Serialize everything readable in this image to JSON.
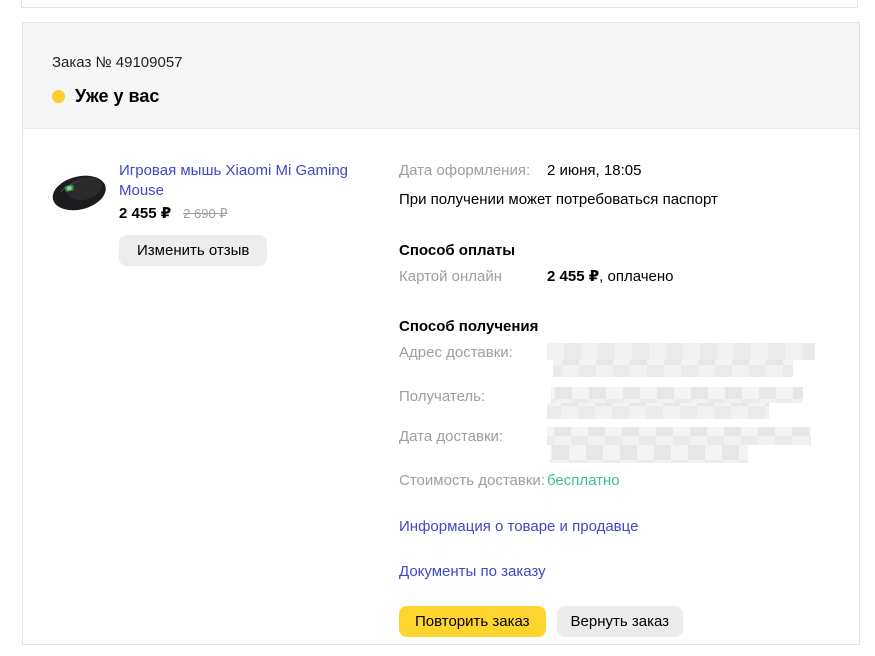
{
  "order": {
    "number_label": "Заказ № 49109057",
    "status": "Уже у вас"
  },
  "product": {
    "title": "Игровая мышь Xiaomi Mi Gaming Mouse",
    "price": "2 455 ₽",
    "old_price": "2 690 ₽",
    "review_button": "Изменить отзыв"
  },
  "details": {
    "date_label": "Дата оформления:",
    "date_value": "2 июня, 18:05",
    "passport_note": "При получении может потребоваться паспорт",
    "payment": {
      "heading": "Способ оплаты",
      "method_label": "Картой онлайн",
      "amount_bold": "2 455 ₽",
      "amount_rest": ", оплачено"
    },
    "delivery": {
      "heading": "Способ получения",
      "address_label": "Адрес доставки:",
      "recipient_label": "Получатель:",
      "date_label": "Дата доставки:",
      "cost_label": "Стоимость доставки:",
      "cost_value": "бесплатно"
    },
    "links": {
      "product_info": "Информация о товаре и продавце",
      "documents": "Документы по заказу"
    },
    "actions": {
      "repeat": "Повторить заказ",
      "return": "Вернуть заказ"
    }
  },
  "icons": {
    "status_dot": "yellow-status-dot",
    "product_image": "gaming-mouse-photo"
  },
  "colors": {
    "accent_yellow": "#fed42e",
    "status_dot_yellow": "#fbce2d",
    "link_blue": "#3d49c6",
    "free_green": "#3cc18a",
    "label_gray": "#9e9e9e"
  }
}
